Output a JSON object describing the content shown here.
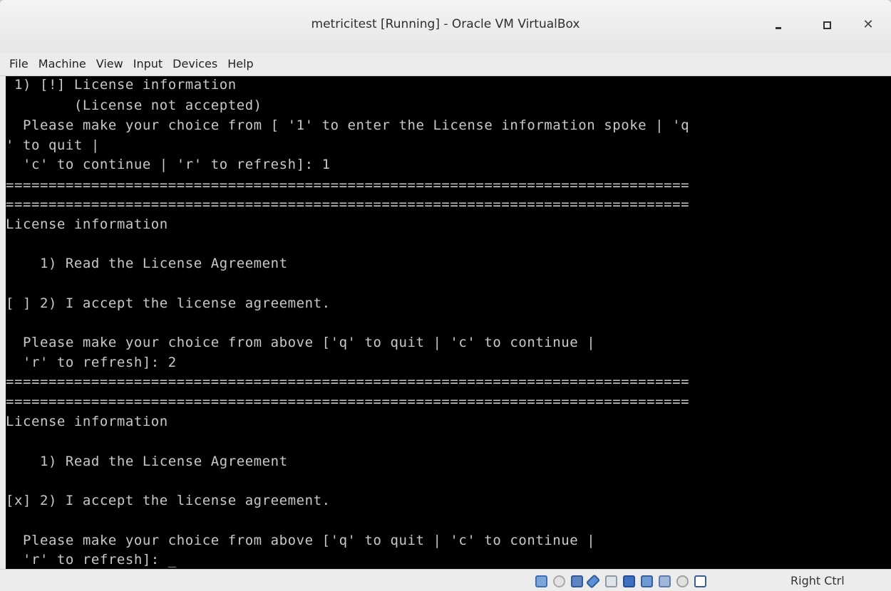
{
  "window": {
    "title": "metricitest [Running] - Oracle VM VirtualBox",
    "buttons": [
      "minimize-icon",
      "maximize-icon",
      "close-icon"
    ]
  },
  "menu": [
    "File",
    "Machine",
    "View",
    "Input",
    "Devices",
    "Help"
  ],
  "console": {
    "lines": [
      " 1) [!] License information",
      "        (License not accepted)",
      "  Please make your choice from [ '1' to enter the License information spoke | 'q",
      "' to quit |",
      "  'c' to continue | 'r' to refresh]: 1",
      "================================================================================",
      "================================================================================",
      "License information",
      "",
      "    1) Read the License Agreement",
      "",
      "[ ] 2) I accept the license agreement.",
      "",
      "  Please make your choice from above ['q' to quit | 'c' to continue |",
      "  'r' to refresh]: 2",
      "================================================================================",
      "================================================================================",
      "License information",
      "",
      "    1) Read the License Agreement",
      "",
      "[x] 2) I accept the license agreement.",
      "",
      "  Please make your choice from above ['q' to quit | 'c' to continue |",
      "  'r' to refresh]: _"
    ]
  },
  "status_bar": {
    "icons": [
      "hard-disk-icon",
      "optical-drive-icon",
      "audio-icon",
      "network-icon",
      "usb-icon",
      "shared-folders-icon",
      "display-icon",
      "video-capture-icon",
      "mouse-integration-icon",
      "keyboard-capture-icon"
    ],
    "host_key": "Right Ctrl"
  },
  "colors": {
    "console_bg": "#000000",
    "console_text": "#c8c8c8",
    "chrome_bg": "#ececec"
  }
}
